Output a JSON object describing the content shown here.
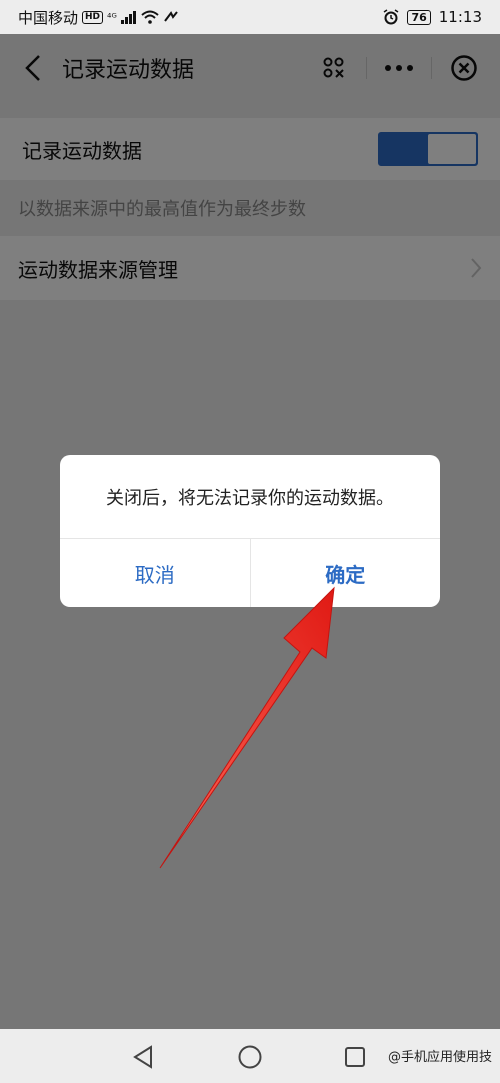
{
  "status_bar": {
    "carrier": "中国移动",
    "hd": "HD",
    "signal": "⁴ᴳ",
    "battery": "76",
    "time": "11:13"
  },
  "nav": {
    "title": "记录运动数据"
  },
  "settings": {
    "record_label": "记录运动数据",
    "record_enabled": true,
    "hint": "以数据来源中的最高值作为最终步数",
    "source_label": "运动数据来源管理"
  },
  "dialog": {
    "message": "关闭后，将无法记录你的运动数据。",
    "cancel": "取消",
    "confirm": "确定"
  },
  "watermark": "@手机应用使用技",
  "colors": {
    "accent": "#2c6bc4",
    "arrow": "#e8201c"
  }
}
